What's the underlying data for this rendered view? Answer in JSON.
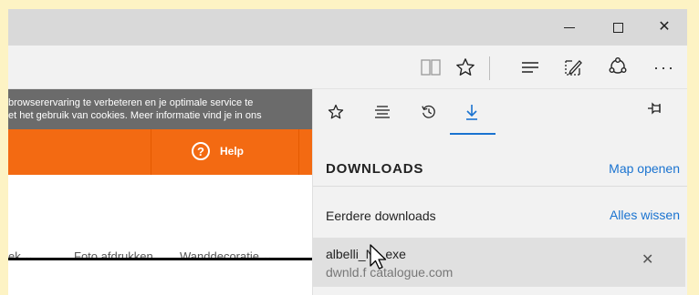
{
  "window": {
    "minimize_icon": "minimize-icon",
    "maximize_icon": "maximize-icon",
    "close_glyph": "✕"
  },
  "toolbar": {
    "icons": [
      "reading-view-icon",
      "favorite-star-icon",
      "hub-icon",
      "web-note-icon",
      "share-icon",
      "more-icon"
    ],
    "more_glyph": "···"
  },
  "page": {
    "cookie_line1": "browserervaring te verbeteren en je optimale service te",
    "cookie_line2": "et het gebruik van cookies. Meer informatie vind je in ons",
    "help_glyph": "?",
    "help_label": "Help",
    "nav_item1": "ek ⌄",
    "nav_item2": "Foto afdrukken",
    "nav_item3": "Wanddecoratie ⌄",
    "accent_color": "#f36a12"
  },
  "hub": {
    "tabs": [
      "favorites",
      "reading-list",
      "history",
      "downloads"
    ],
    "active_tab": "downloads",
    "title": "DOWNLOADS",
    "open_folder": "Map openen",
    "earlier_label": "Eerdere downloads",
    "clear_all": "Alles wissen",
    "downloads": [
      {
        "file": "albelli_NL.exe",
        "host": "dwnld.f  catalogue.com"
      }
    ],
    "link_color": "#1a73d0"
  }
}
